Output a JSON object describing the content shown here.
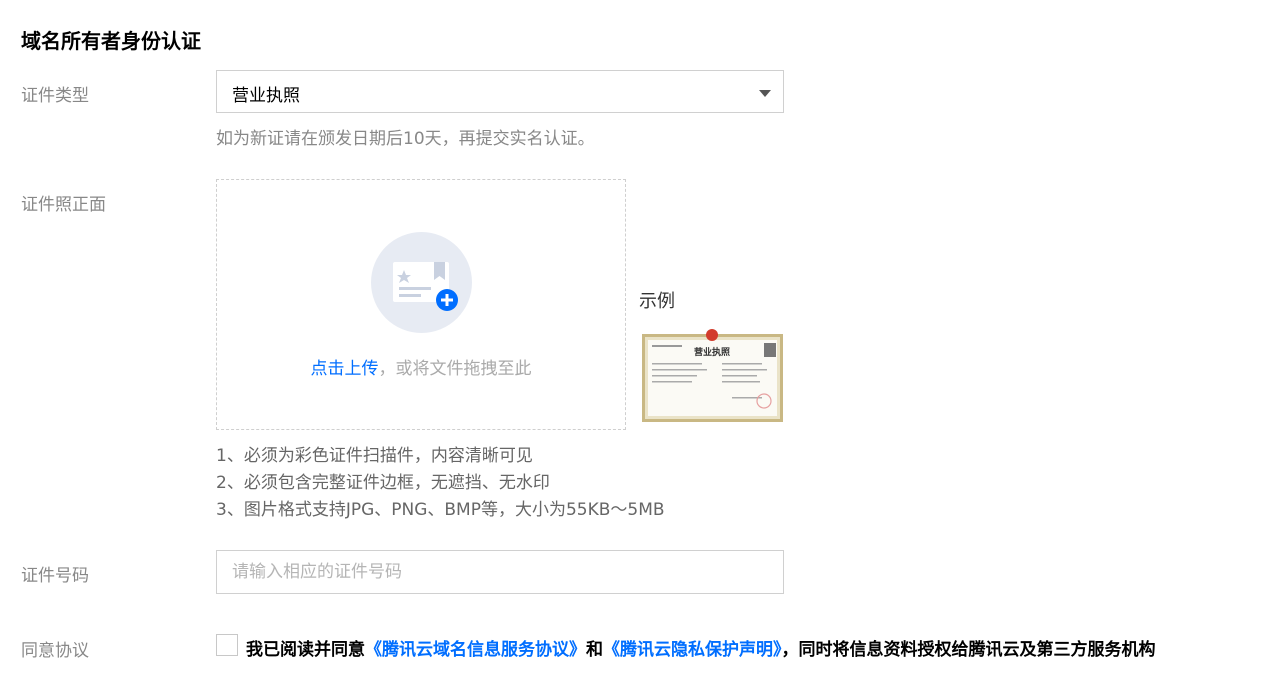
{
  "section_title": "域名所有者身份认证",
  "labels": {
    "cert_type": "证件类型",
    "cert_front": "证件照正面",
    "cert_number": "证件号码",
    "agree": "同意协议"
  },
  "cert_type": {
    "selected": "营业执照",
    "hint": "如为新证请在颁发日期后10天，再提交实名认证。"
  },
  "upload": {
    "link_text": "点击上传",
    "rest_text": "，或将文件拖拽至此",
    "example_label": "示例",
    "example_title": "营业执照",
    "requirements": [
      "1、必须为彩色证件扫描件，内容清晰可见",
      "2、必须包含完整证件边框，无遮挡、无水印",
      "3、图片格式支持JPG、PNG、BMP等，大小为55KB～5MB"
    ]
  },
  "cert_number": {
    "placeholder": "请输入相应的证件号码"
  },
  "agreement": {
    "prefix": "我已阅读并同意",
    "link1": "《腾讯云域名信息服务协议》",
    "and": "和",
    "link2": "《腾讯云隐私保护声明》",
    "suffix": "，同时将信息资料授权给腾讯云及第三方服务机构"
  },
  "colors": {
    "link": "#006eff",
    "label": "#888888",
    "border": "#d0d0d0"
  }
}
